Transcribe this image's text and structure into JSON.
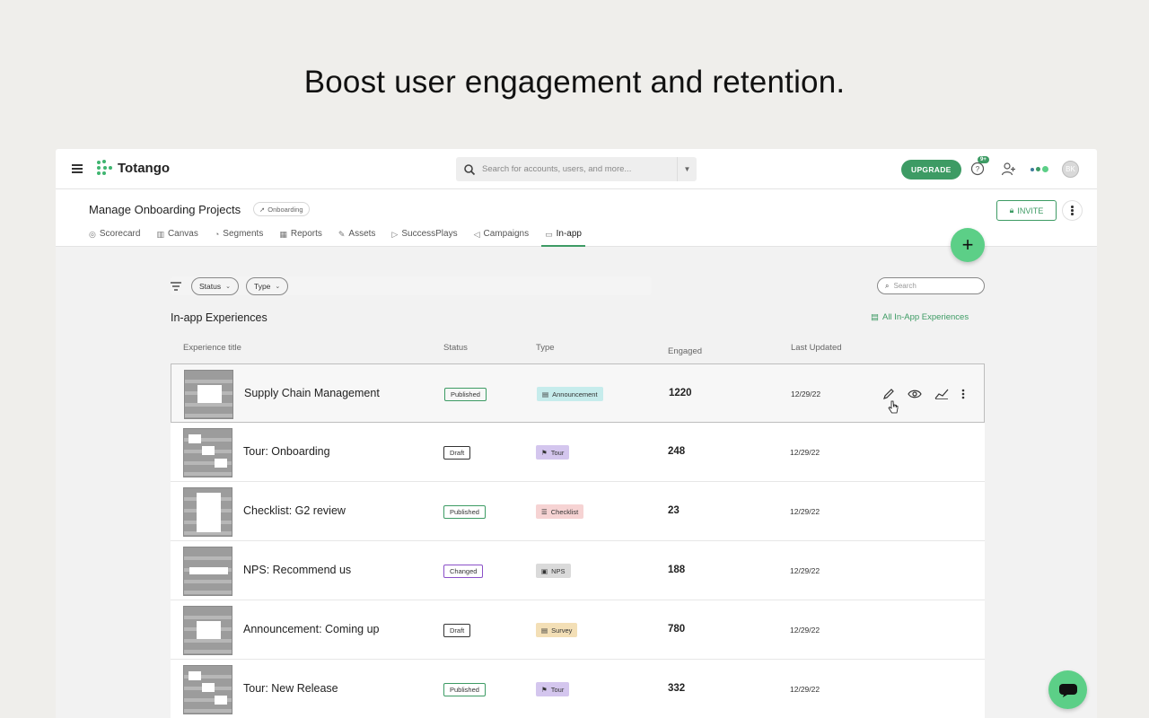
{
  "hero": {
    "headline": "Boost user engagement and retention."
  },
  "app": {
    "logo_text": "Totango",
    "search_placeholder": "Search for accounts, users, and more...",
    "upgrade_label": "UPGRADE",
    "help_badge": "9+",
    "avatar_initials": "BK",
    "project": {
      "title": "Manage Onboarding Projects",
      "chip": "Onboarding"
    },
    "invite_label": "INVITE",
    "tabs": [
      {
        "label": "Scorecard",
        "icon": "scorecard-icon",
        "glyph": "◎"
      },
      {
        "label": "Canvas",
        "icon": "canvas-icon",
        "glyph": "▥"
      },
      {
        "label": "Segments",
        "icon": "segments-icon",
        "glyph": "◔"
      },
      {
        "label": "Reports",
        "icon": "reports-icon",
        "glyph": "▦"
      },
      {
        "label": "Assets",
        "icon": "assets-icon",
        "glyph": "✎"
      },
      {
        "label": "SuccessPlays",
        "icon": "play-icon",
        "glyph": "▷"
      },
      {
        "label": "Campaigns",
        "icon": "megaphone-icon",
        "glyph": "◁"
      },
      {
        "label": "In-app",
        "icon": "inapp-icon",
        "glyph": "▭",
        "active": true
      }
    ],
    "fab_label": "+"
  },
  "filters": {
    "status_label": "Status",
    "type_label": "Type",
    "search_placeholder": "Search"
  },
  "section": {
    "title": "In-app Experiences",
    "all_link": "All In-App Experiences"
  },
  "columns": {
    "title": "Experience title",
    "status": "Status",
    "type": "Type",
    "engaged": "Engaged",
    "updated": "Last Updated"
  },
  "rows": [
    {
      "title": "Supply Chain Management",
      "status": "Published",
      "status_kind": "published",
      "type": "Announcement",
      "type_kind": "announcement",
      "type_glyph": "▤",
      "engaged": "1220",
      "updated": "12/29/22",
      "thumb": "announcement"
    },
    {
      "title": "Tour: Onboarding",
      "status": "Draft",
      "status_kind": "draft",
      "type": "Tour",
      "type_kind": "tour",
      "type_glyph": "⚑",
      "engaged": "248",
      "updated": "12/29/22",
      "thumb": "tour"
    },
    {
      "title": "Checklist: G2 review",
      "status": "Published",
      "status_kind": "published",
      "type": "Checklist",
      "type_kind": "checklist",
      "type_glyph": "☰",
      "engaged": "23",
      "updated": "12/29/22",
      "thumb": "checklist"
    },
    {
      "title": "NPS: Recommend us",
      "status": "Changed",
      "status_kind": "changed",
      "type": "NPS",
      "type_kind": "nps",
      "type_glyph": "▣",
      "engaged": "188",
      "updated": "12/29/22",
      "thumb": "nps"
    },
    {
      "title": "Announcement: Coming up",
      "status": "Draft",
      "status_kind": "draft",
      "type": "Survey",
      "type_kind": "survey",
      "type_glyph": "▤",
      "engaged": "780",
      "updated": "12/29/22",
      "thumb": "announcement"
    },
    {
      "title": "Tour: New Release",
      "status": "Published",
      "status_kind": "published",
      "type": "Tour",
      "type_kind": "tour",
      "type_glyph": "⚑",
      "engaged": "332",
      "updated": "12/29/22",
      "thumb": "tour"
    }
  ],
  "colors": {
    "brand_green": "#3d9b64",
    "fab_green": "#5ccf87",
    "background": "#efeeeb"
  }
}
